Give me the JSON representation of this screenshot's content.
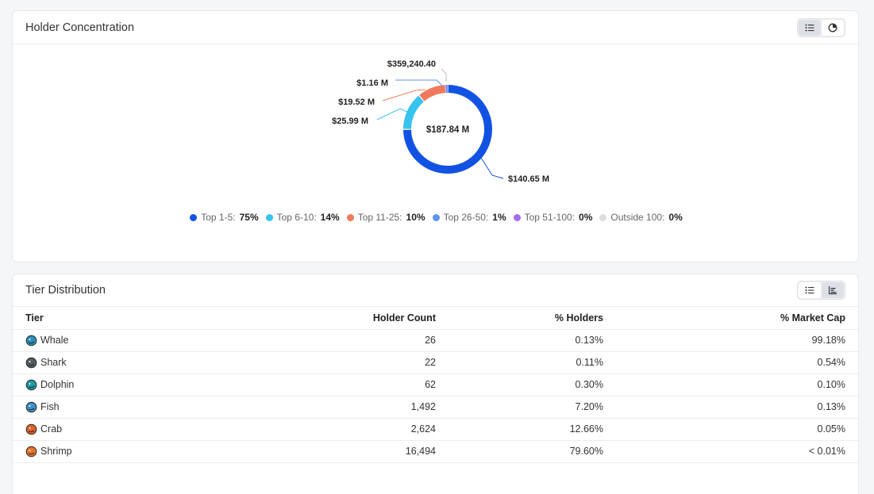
{
  "holder_concentration": {
    "title": "Holder Concentration",
    "center_label": "$187.84 M",
    "slice_labels": [
      "$140.65 M",
      "$25.99 M",
      "$19.52 M",
      "$1.16 M",
      "$359,240.40"
    ],
    "legend": [
      {
        "label": "Top 1-5:",
        "value": "75%",
        "color": "#1252e3"
      },
      {
        "label": "Top 6-10:",
        "value": "14%",
        "color": "#36c3ef"
      },
      {
        "label": "Top 11-25:",
        "value": "10%",
        "color": "#f07a5b"
      },
      {
        "label": "Top 26-50:",
        "value": "1%",
        "color": "#5f94f0"
      },
      {
        "label": "Top 51-100:",
        "value": "0%",
        "color": "#a56cf0"
      },
      {
        "label": "Outside 100:",
        "value": "0%",
        "color": "#dcdee2"
      }
    ]
  },
  "chart_data": {
    "type": "pie",
    "categories": [
      "Top 1-5",
      "Top 6-10",
      "Top 11-25",
      "Top 26-50",
      "Top 51-100",
      "Outside 100"
    ],
    "values": [
      140.65,
      25.99,
      19.52,
      1.16,
      0.35924,
      0.0
    ],
    "percentages": [
      75,
      14,
      10,
      1,
      0,
      0
    ],
    "colors": [
      "#1252e3",
      "#36c3ef",
      "#f07a5b",
      "#5f94f0",
      "#a56cf0",
      "#dcdee2"
    ],
    "total_label": "$187.84 M",
    "legend_position": "bottom"
  },
  "tier_distribution": {
    "title": "Tier Distribution",
    "headers": {
      "tier": "Tier",
      "count": "Holder Count",
      "holders": "% Holders",
      "cap": "% Market Cap"
    },
    "rows": [
      {
        "tier": "Whale",
        "icon": "whale-icon",
        "icon_color": "#2a8fb8",
        "count": "26",
        "holders": "0.13%",
        "cap": "99.18%"
      },
      {
        "tier": "Shark",
        "icon": "shark-icon",
        "icon_color": "#555b63",
        "count": "22",
        "holders": "0.11%",
        "cap": "0.54%"
      },
      {
        "tier": "Dolphin",
        "icon": "dolphin-icon",
        "icon_color": "#1e9aa8",
        "count": "62",
        "holders": "0.30%",
        "cap": "0.10%"
      },
      {
        "tier": "Fish",
        "icon": "fish-icon",
        "icon_color": "#3f8fc9",
        "count": "1,492",
        "holders": "7.20%",
        "cap": "0.13%"
      },
      {
        "tier": "Crab",
        "icon": "crab-icon",
        "icon_color": "#e0612a",
        "count": "2,624",
        "holders": "12.66%",
        "cap": "0.05%"
      },
      {
        "tier": "Shrimp",
        "icon": "shrimp-icon",
        "icon_color": "#e8732e",
        "count": "16,494",
        "holders": "79.60%",
        "cap": "< 0.01%"
      }
    ]
  }
}
